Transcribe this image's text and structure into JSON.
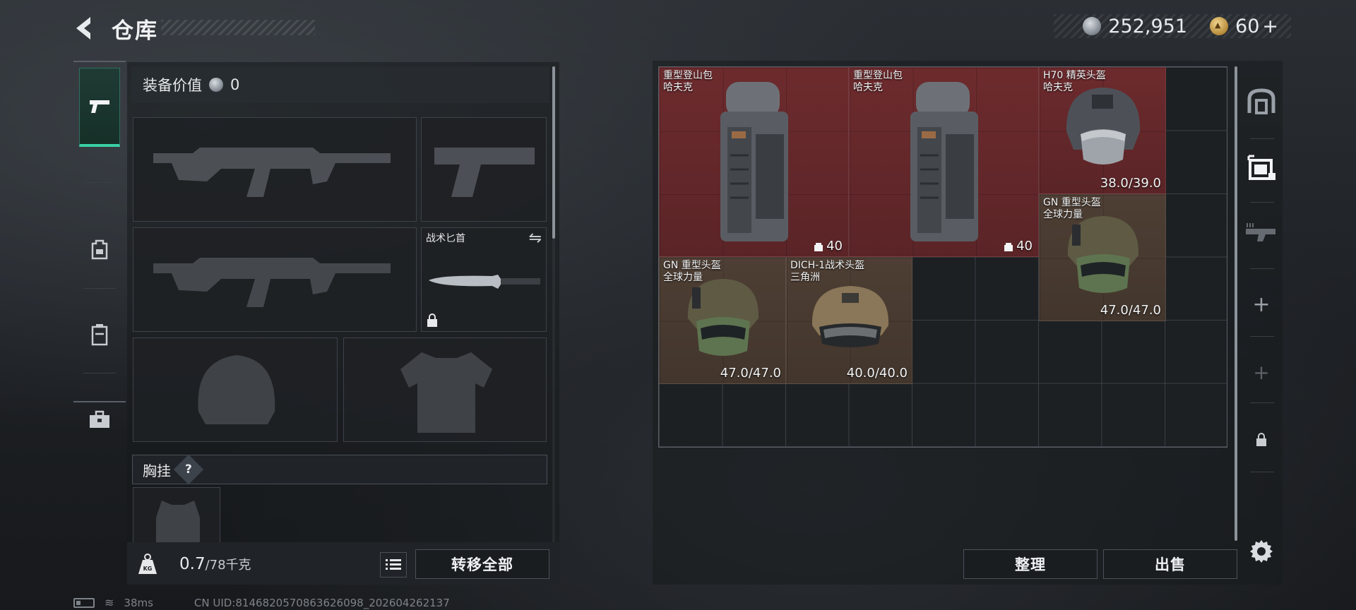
{
  "header": {
    "title": "仓库",
    "silver_amount": "252,951",
    "gold_amount": "60",
    "gold_plus": "+"
  },
  "left_nav": {
    "items": [
      {
        "icon": "pistol-icon",
        "active": true
      },
      {
        "icon": "backpack-icon",
        "active": false
      },
      {
        "icon": "container-icon",
        "active": false
      },
      {
        "icon": "toolbox-icon",
        "active": false
      }
    ]
  },
  "loadout": {
    "value_label": "装备价值",
    "value_amount": "0",
    "knife_label": "战术匕首",
    "chest_rig_label": "胸挂",
    "help_label": "?",
    "weight_current": "0.7",
    "weight_max": "/78千克",
    "weight_icon_text": "KG",
    "transfer_all_label": "转移全部"
  },
  "stash": {
    "items": [
      {
        "name_line1": "重型登山包",
        "name_line2": "哈夫克",
        "capacity": "40",
        "style": "red"
      },
      {
        "name_line1": "重型登山包",
        "name_line2": "哈夫克",
        "capacity": "40",
        "style": "red"
      },
      {
        "name_line1": "H70 精英头盔",
        "name_line2": "哈夫克",
        "durability": "38.0/39.0",
        "style": "red"
      },
      {
        "name_line1": "GN 重型头盔",
        "name_line2": "全球力量",
        "durability": "47.0/47.0",
        "style": "brown"
      },
      {
        "name_line1": "GN 重型头盔",
        "name_line2": "全球力量",
        "durability": "47.0/47.0",
        "style": "brown"
      },
      {
        "name_line1": "DICH-1战术头盔",
        "name_line2": "三角洲",
        "durability": "40.0/40.0",
        "style": "brown"
      }
    ],
    "sort_label": "整理",
    "sell_label": "出售"
  },
  "right_rail": {
    "items": [
      "stash-home-icon",
      "stash-tab-icon",
      "weapon-tab-icon",
      "add-tab-icon",
      "add-tab-disabled-icon",
      "lock-icon"
    ],
    "add_label": "+"
  },
  "status_bar": {
    "ping": "38ms",
    "uid": "CN UID:8146820570863626098_202604262137"
  },
  "colors": {
    "accent": "#3ad1a4",
    "rare_red": "#742b2e",
    "common_brown": "#534236"
  }
}
